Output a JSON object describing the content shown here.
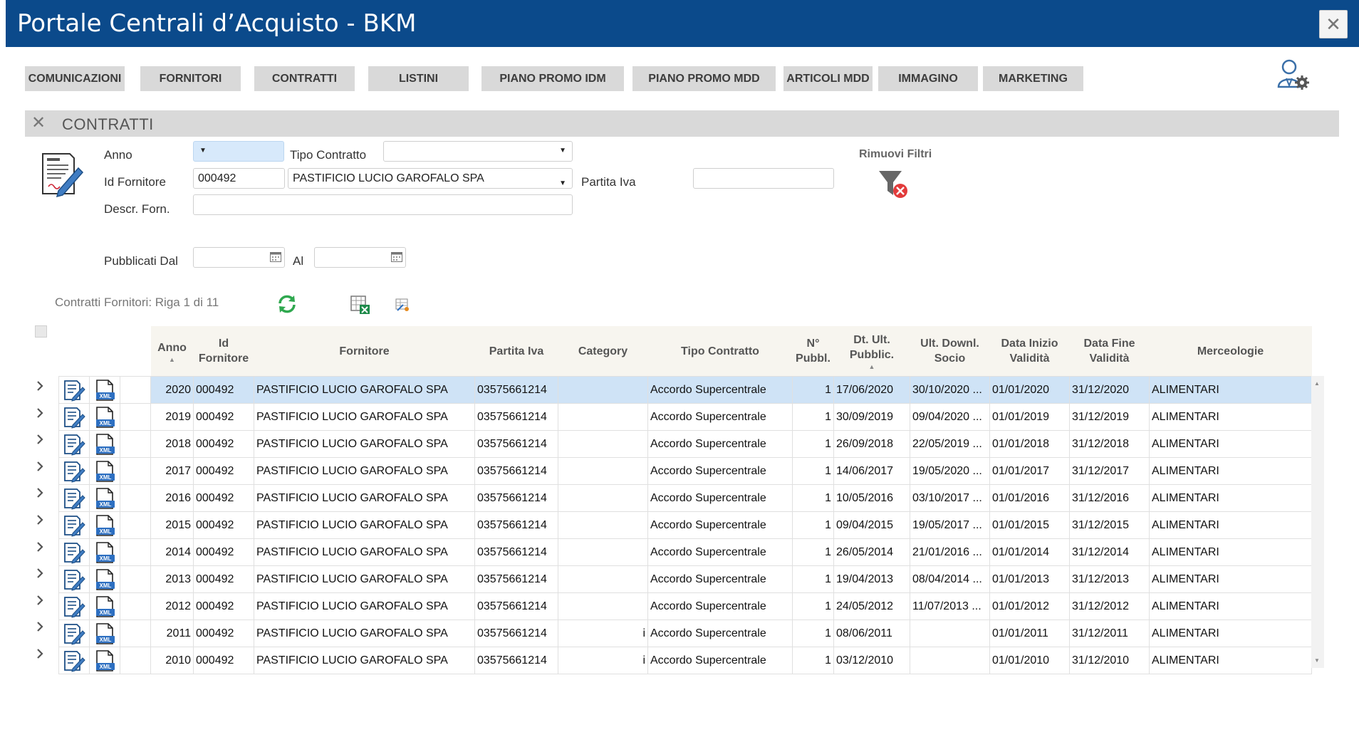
{
  "window": {
    "title": "Portale Centrali d’Acquisto - BKM",
    "close_label": "✕"
  },
  "nav": [
    {
      "label": "COMUNICAZIONI"
    },
    {
      "label": "FORNITORI"
    },
    {
      "label": "CONTRATTI"
    },
    {
      "label": "LISTINI"
    },
    {
      "label": "PIANO PROMO IDM"
    },
    {
      "label": "PIANO PROMO MDD"
    },
    {
      "label": "ARTICOLI MDD"
    },
    {
      "label": "IMMAGINO"
    },
    {
      "label": "MARKETING"
    }
  ],
  "section": {
    "close_label": "✕",
    "title": "CONTRATTI"
  },
  "filters": {
    "anno_label": "Anno",
    "anno_value": "",
    "tipo_contratto_label": "Tipo Contratto",
    "tipo_contratto_value": "",
    "id_fornitore_label": "Id Fornitore",
    "id_fornitore_value": "000492",
    "fornitore_select_value": "PASTIFICIO LUCIO GAROFALO SPA",
    "partita_iva_label": "Partita Iva",
    "partita_iva_value": "",
    "descr_forn_label": "Descr. Forn.",
    "descr_forn_value": "",
    "pubblicati_dal_label": "Pubblicati Dal",
    "pubblicati_dal_value": "",
    "al_label": "Al",
    "al_value": "",
    "rimuovi_filtri_label": "Rimuovi Filtri"
  },
  "grid": {
    "caption": "Contratti Fornitori: Riga 1 di 11",
    "columns": {
      "anno": "Anno",
      "id_fornitore": "Id Fornitore",
      "fornitore": "Fornitore",
      "partita_iva": "Partita Iva",
      "category": "Category",
      "tipo_contratto": "Tipo Contratto",
      "n_pubbl": "N° Pubbl.",
      "dt_ult_pubblic": "Dt. Ult. Pubblic.",
      "ult_downl_socio": "Ult. Downl. Socio",
      "data_inizio": "Data Inizio Validità",
      "data_fine": "Data Fine Validità",
      "merceologie": "Merceologie"
    },
    "rows": [
      {
        "anno": "2020",
        "id": "000492",
        "fornitore": "PASTIFICIO LUCIO GAROFALO SPA",
        "piva": "03575661214",
        "category": "",
        "tipo": "Accordo Supercentrale",
        "npubbl": "1",
        "dt_ult": "17/06/2020",
        "ult_downl": "30/10/2020 ...",
        "inizio": "01/01/2020",
        "fine": "31/12/2020",
        "merc": "ALIMENTARI"
      },
      {
        "anno": "2019",
        "id": "000492",
        "fornitore": "PASTIFICIO LUCIO GAROFALO SPA",
        "piva": "03575661214",
        "category": "",
        "tipo": "Accordo Supercentrale",
        "npubbl": "1",
        "dt_ult": "30/09/2019",
        "ult_downl": "09/04/2020 ...",
        "inizio": "01/01/2019",
        "fine": "31/12/2019",
        "merc": "ALIMENTARI"
      },
      {
        "anno": "2018",
        "id": "000492",
        "fornitore": "PASTIFICIO LUCIO GAROFALO SPA",
        "piva": "03575661214",
        "category": "",
        "tipo": "Accordo Supercentrale",
        "npubbl": "1",
        "dt_ult": "26/09/2018",
        "ult_downl": "22/05/2019 ...",
        "inizio": "01/01/2018",
        "fine": "31/12/2018",
        "merc": "ALIMENTARI"
      },
      {
        "anno": "2017",
        "id": "000492",
        "fornitore": "PASTIFICIO LUCIO GAROFALO SPA",
        "piva": "03575661214",
        "category": "",
        "tipo": "Accordo Supercentrale",
        "npubbl": "1",
        "dt_ult": "14/06/2017",
        "ult_downl": "19/05/2020 ...",
        "inizio": "01/01/2017",
        "fine": "31/12/2017",
        "merc": "ALIMENTARI"
      },
      {
        "anno": "2016",
        "id": "000492",
        "fornitore": "PASTIFICIO LUCIO GAROFALO SPA",
        "piva": "03575661214",
        "category": "",
        "tipo": "Accordo Supercentrale",
        "npubbl": "1",
        "dt_ult": "10/05/2016",
        "ult_downl": "03/10/2017 ...",
        "inizio": "01/01/2016",
        "fine": "31/12/2016",
        "merc": "ALIMENTARI"
      },
      {
        "anno": "2015",
        "id": "000492",
        "fornitore": "PASTIFICIO LUCIO GAROFALO SPA",
        "piva": "03575661214",
        "category": "",
        "tipo": "Accordo Supercentrale",
        "npubbl": "1",
        "dt_ult": "09/04/2015",
        "ult_downl": "19/05/2017 ...",
        "inizio": "01/01/2015",
        "fine": "31/12/2015",
        "merc": "ALIMENTARI"
      },
      {
        "anno": "2014",
        "id": "000492",
        "fornitore": "PASTIFICIO LUCIO GAROFALO SPA",
        "piva": "03575661214",
        "category": "",
        "tipo": "Accordo Supercentrale",
        "npubbl": "1",
        "dt_ult": "26/05/2014",
        "ult_downl": "21/01/2016 ...",
        "inizio": "01/01/2014",
        "fine": "31/12/2014",
        "merc": "ALIMENTARI"
      },
      {
        "anno": "2013",
        "id": "000492",
        "fornitore": "PASTIFICIO LUCIO GAROFALO SPA",
        "piva": "03575661214",
        "category": "",
        "tipo": "Accordo Supercentrale",
        "npubbl": "1",
        "dt_ult": "19/04/2013",
        "ult_downl": "08/04/2014 ...",
        "inizio": "01/01/2013",
        "fine": "31/12/2013",
        "merc": "ALIMENTARI"
      },
      {
        "anno": "2012",
        "id": "000492",
        "fornitore": "PASTIFICIO LUCIO GAROFALO SPA",
        "piva": "03575661214",
        "category": "",
        "tipo": "Accordo Supercentrale",
        "npubbl": "1",
        "dt_ult": "24/05/2012",
        "ult_downl": "11/07/2013 ...",
        "inizio": "01/01/2012",
        "fine": "31/12/2012",
        "merc": "ALIMENTARI"
      },
      {
        "anno": "2011",
        "id": "000492",
        "fornitore": "PASTIFICIO LUCIO GAROFALO SPA",
        "piva": "03575661214",
        "category": "i",
        "tipo": "Accordo Supercentrale",
        "npubbl": "1",
        "dt_ult": "08/06/2011",
        "ult_downl": "",
        "inizio": "01/01/2011",
        "fine": "31/12/2011",
        "merc": "ALIMENTARI"
      },
      {
        "anno": "2010",
        "id": "000492",
        "fornitore": "PASTIFICIO LUCIO GAROFALO SPA",
        "piva": "03575661214",
        "category": "i",
        "tipo": "Accordo Supercentrale",
        "npubbl": "1",
        "dt_ult": "03/12/2010",
        "ult_downl": "",
        "inizio": "01/01/2010",
        "fine": "31/12/2010",
        "merc": "ALIMENTARI"
      }
    ]
  },
  "colors": {
    "titlebar": "#0b4a8b",
    "button_bg": "#d9d9d9",
    "selected_row": "#cfe3f6",
    "header_bg": "#f7f5ef",
    "refresh_icon": "#2fa84f",
    "filter_remove": "#e23b3b"
  },
  "icons": [
    "close-icon",
    "user-settings-icon",
    "document-edit-icon",
    "calendar-icon",
    "filter-remove-icon",
    "refresh-icon",
    "export-excel-icon",
    "export-icon",
    "chevron-right-icon",
    "xml-file-icon"
  ]
}
